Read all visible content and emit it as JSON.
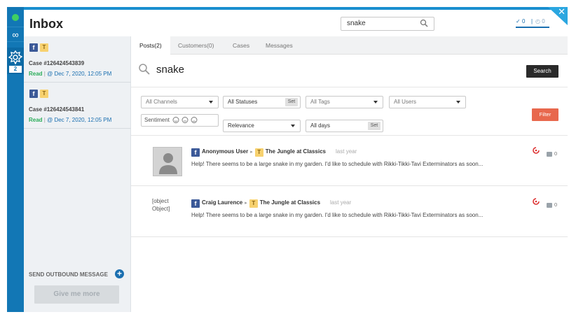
{
  "app": {
    "title": "Inbox"
  },
  "rail": {
    "badge_count": "2"
  },
  "global_search": {
    "value": "snake"
  },
  "status_counts": {
    "checked": "0",
    "pending": "0"
  },
  "cases": [
    {
      "id_label": "Case #126424543839",
      "status": "Read",
      "date": "@ Dec 7, 2020, 12:05 PM"
    },
    {
      "id_label": "Case #126424543841",
      "status": "Read",
      "date": "@ Dec 7, 2020, 12:05 PM"
    }
  ],
  "left_panel": {
    "send_outbound_label": "SEND OUTBOUND MESSAGE",
    "give_more_label": "Give me more"
  },
  "tabs": [
    {
      "label": "Posts(2)",
      "active": true
    },
    {
      "label": "Customers(0)",
      "active": false
    },
    {
      "label": "Cases",
      "active": false
    },
    {
      "label": "Messages",
      "active": false
    }
  ],
  "search": {
    "term": "snake",
    "button_label": "Search"
  },
  "filters": {
    "channels": "All Channels",
    "statuses": "All Statuses",
    "statuses_set": "Set",
    "tags": "All Tags",
    "users": "All Users",
    "sentiment_label": "Sentiment",
    "relevance": "Relevance",
    "days": "All days",
    "days_set": "Set",
    "filter_button": "Filter"
  },
  "posts": [
    {
      "author": "Anonymous User",
      "page": "The Jungle at Classics",
      "time": "last year",
      "text": "Help! There seems to be a large snake in my garden. I'd like to schedule with Rikki-Tikki-Tavi Exterminators as soon...",
      "comments": "0",
      "avatar_alt": ""
    },
    {
      "author": "Craig Laurence",
      "page": "The Jungle at Classics",
      "time": "last year",
      "text": "Help! There seems to be a large snake in my garden. I'd like to schedule with Rikki-Tikki-Tavi Exterminators as soon...",
      "comments": "0",
      "avatar_alt": "[object Object]"
    }
  ],
  "icons": {
    "facebook": "f",
    "tag": "T",
    "close": "✕"
  },
  "colors": {
    "rail": "#1277b5",
    "accent": "#1a8fcf",
    "read_status": "#2bad5a",
    "filter_button": "#e8684d",
    "search_button": "#2a2a2a"
  }
}
